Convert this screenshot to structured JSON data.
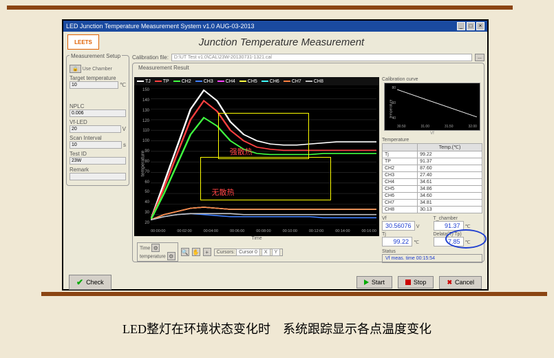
{
  "window": {
    "title": "LED Junction Temperature Measurement System v1.0 AUG-03-2013",
    "main_title": "Junction Temperature Measurement"
  },
  "logo_text": "LEETS",
  "setup": {
    "legend": "Measurement Setup",
    "use_chamber_label": "Use Chamber",
    "target_temp_label": "Target temperature",
    "target_temp_value": "10",
    "target_temp_unit": "℃",
    "nplc_label": "NPLC",
    "nplc_value": "0.006",
    "vf_led_label": "Vf-LED",
    "vf_led_value": "20",
    "vf_led_unit": "V",
    "scan_interval_label": "Scan Interval",
    "scan_interval_value": "10",
    "scan_interval_unit": "s",
    "test_id_label": "Test ID",
    "test_id_value": "23W",
    "remark_label": "Remark"
  },
  "calibration": {
    "label": "Calibration file:",
    "path": "D:\\UT Test v1.0\\CAL\\23W-20130731-1321.cal",
    "browse_label": "..."
  },
  "meas_legend": "Measurement Result",
  "channels": [
    "TJ",
    "TP",
    "CH2",
    "CH3",
    "CH4",
    "CH5",
    "CH6",
    "CH7",
    "CH8"
  ],
  "channel_colors": [
    "#ffffff",
    "#ff4040",
    "#40ff40",
    "#4080ff",
    "#ff40ff",
    "#ffff40",
    "#40ffff",
    "#ff8040",
    "#c0c0c0"
  ],
  "chart_data": {
    "type": "line",
    "xlabel": "Time",
    "ylabel": "temperature",
    "ylim": [
      20,
      150
    ],
    "yticks": [
      20,
      30,
      40,
      50,
      60,
      70,
      80,
      90,
      100,
      110,
      120,
      130,
      140,
      150
    ],
    "xticks": [
      "00:00:00",
      "00:02:00",
      "00:04:00",
      "00:06:00",
      "00:08:00",
      "00:10:00",
      "00:12:00",
      "00:14:00",
      "00:16:00"
    ],
    "series": [
      {
        "name": "TJ",
        "color": "#ffffff",
        "values": [
          25,
          60,
          95,
          130,
          148,
          138,
          118,
          106,
          100,
          97,
          96,
          96,
          97,
          98,
          99,
          99,
          99,
          99
        ]
      },
      {
        "name": "TP",
        "color": "#ff4040",
        "values": [
          25,
          55,
          88,
          120,
          138,
          128,
          110,
          100,
          94,
          92,
          91,
          91,
          91,
          91,
          91,
          91,
          91,
          91
        ]
      },
      {
        "name": "CH2",
        "color": "#40ff40",
        "values": [
          25,
          50,
          78,
          106,
          122,
          114,
          100,
          92,
          88,
          87,
          87,
          87,
          87,
          88,
          88,
          88,
          88,
          88
        ]
      },
      {
        "name": "CH3",
        "color": "#4080ff",
        "values": [
          25,
          28,
          30,
          31,
          30,
          29,
          28,
          28,
          28,
          28,
          28,
          28,
          28,
          27,
          27,
          27,
          27,
          27
        ]
      },
      {
        "name": "CH4",
        "color": "#ff40ff",
        "values": [
          25,
          30,
          33,
          36,
          37,
          36,
          35,
          35,
          35,
          35,
          35,
          35,
          35,
          35,
          35,
          35,
          35,
          35
        ]
      },
      {
        "name": "CH5",
        "color": "#ffff40",
        "values": [
          25,
          30,
          33,
          36,
          37,
          36,
          35,
          35,
          35,
          35,
          35,
          35,
          35,
          35,
          35,
          35,
          35,
          35
        ]
      },
      {
        "name": "CH6",
        "color": "#40ffff",
        "values": [
          25,
          30,
          33,
          36,
          37,
          36,
          35,
          35,
          35,
          35,
          35,
          35,
          35,
          35,
          35,
          35,
          35,
          35
        ]
      },
      {
        "name": "CH7",
        "color": "#ff8040",
        "values": [
          25,
          30,
          33,
          36,
          37,
          36,
          35,
          35,
          35,
          35,
          35,
          35,
          35,
          35,
          35,
          35,
          35,
          35
        ]
      },
      {
        "name": "CH8",
        "color": "#c0c0c0",
        "values": [
          25,
          28,
          30,
          31,
          31,
          31,
          31,
          30,
          30,
          30,
          30,
          30,
          30,
          30,
          30,
          30,
          30,
          30
        ]
      }
    ],
    "annotations": [
      {
        "text": "强散热",
        "box": [
          0.3,
          0.18,
          0.7,
          0.52
        ]
      },
      {
        "text": "无散热",
        "box": [
          0.22,
          0.5,
          0.8,
          0.82
        ]
      }
    ]
  },
  "calib_chart": {
    "legend": "Calibration curve",
    "xlabel": "Vf",
    "ylabel": "temperature",
    "xticks": [
      "30.50",
      "31.00",
      "31.50",
      "32.00"
    ],
    "yticks": [
      "40",
      "60",
      "80"
    ]
  },
  "temperature_table": {
    "legend": "Temperature",
    "header": "Temp.(℃)",
    "rows": [
      {
        "ch": "Tj",
        "val": "99.22"
      },
      {
        "ch": "TP",
        "val": "91.37"
      },
      {
        "ch": "CH2",
        "val": "87.60"
      },
      {
        "ch": "CH3",
        "val": "27.40"
      },
      {
        "ch": "CH4",
        "val": "34.61"
      },
      {
        "ch": "CH5",
        "val": "34.86"
      },
      {
        "ch": "CH6",
        "val": "34.60"
      },
      {
        "ch": "CH7",
        "val": "34.81"
      },
      {
        "ch": "CH8",
        "val": "30.13"
      }
    ]
  },
  "readouts": {
    "vf_label": "Vf",
    "vf_value": "30.56076",
    "vf_unit": "V",
    "tchamber_label": "T_chamber",
    "tchamber_value": "91.37",
    "tchamber_unit": "℃",
    "tj_label": "Tj",
    "tj_value": "99.22",
    "tj_unit": "℃",
    "delta_label": "Delata(Tj-Tp)",
    "delta_value": "7.85",
    "delta_unit": "℃"
  },
  "status": {
    "legend": "Status",
    "text": "Vf meas. time 00:15:54"
  },
  "axis_panel": {
    "time_label": "Time",
    "temp_label": "temperature"
  },
  "cursor_panel": {
    "label": "Cursors:",
    "name": "Cursor 0",
    "x_header": "X",
    "y_header": "Y"
  },
  "buttons": {
    "check": "Check",
    "start": "Start",
    "stop": "Stop",
    "cancel": "Cancel"
  },
  "caption": "LED整灯在环境状态变化时　系统跟踪显示各点温度变化"
}
